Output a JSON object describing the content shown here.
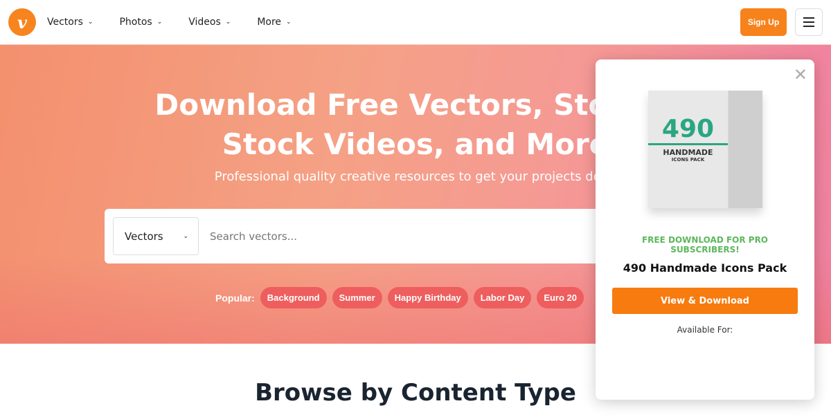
{
  "nav": {
    "logo": "v",
    "items": [
      {
        "label": "Vectors"
      },
      {
        "label": "Photos"
      },
      {
        "label": "Videos"
      },
      {
        "label": "More"
      }
    ],
    "signup": "Sign Up"
  },
  "hero": {
    "title_line1": "Download Free Vectors, Stock P",
    "title_line2": "Stock Videos, and More",
    "subtitle": "Professional quality creative resources to get your projects done",
    "search": {
      "category": "Vectors",
      "placeholder": "Search vectors..."
    },
    "popular_label": "Popular:",
    "tags": [
      "Background",
      "Summer",
      "Happy Birthday",
      "Labor Day",
      "Euro 20"
    ]
  },
  "browse_title": "Browse by Content Type",
  "modal": {
    "box_number": "490",
    "box_title": "HANDMADE",
    "box_subtitle": "ICONS PACK",
    "promo": "FREE DOWNLOAD FOR PRO SUBSCRIBERS!",
    "title": "490 Handmade Icons Pack",
    "button": "View & Download",
    "available": "Available For:"
  },
  "colors": {
    "accent": "#f7821b",
    "promo": "#5cb85c"
  }
}
